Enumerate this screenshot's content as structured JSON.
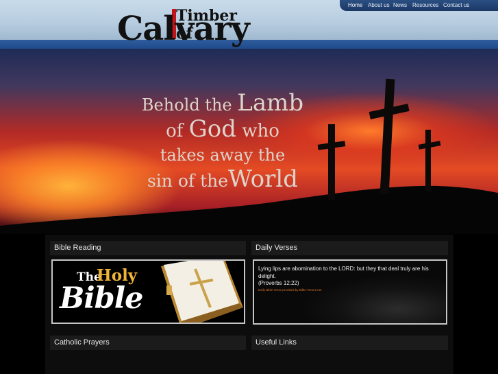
{
  "logo": {
    "main": "Calvary",
    "top": "Timber of"
  },
  "nav": {
    "items": [
      {
        "label": "Home",
        "active": true
      },
      {
        "label": "About us"
      },
      {
        "label": "News"
      },
      {
        "label": "Resources"
      },
      {
        "label": "Contact us"
      }
    ]
  },
  "hero": {
    "line1_a": "Behold the",
    "line1_b": "Lamb",
    "line2_a": "of",
    "line2_b": "God",
    "line2_c": "who",
    "line3": "takes away the",
    "line4_a": "sin of the",
    "line4_b": "World"
  },
  "sections": {
    "bible_reading": "Bible Reading",
    "daily_verses": "Daily Verses",
    "catholic_prayers": "Catholic Prayers",
    "useful_links": "Useful Links"
  },
  "bible_banner": {
    "the": "The",
    "holy": "Holy",
    "bible": "Bible"
  },
  "verse": {
    "text": "Lying lips are abomination to the LORD: but they that deal truly are his delight.",
    "reference": "(Proverbs 12:22)",
    "credit": "Daily Bible Verse provided by Bible-Verses.net"
  },
  "colors": {
    "nav_bg": "#1f3f6e",
    "header_bg": "#b7cde0",
    "logo_accent": "#c0161b",
    "bible_holy": "#f0b437",
    "verse_credit": "#d4762b"
  }
}
